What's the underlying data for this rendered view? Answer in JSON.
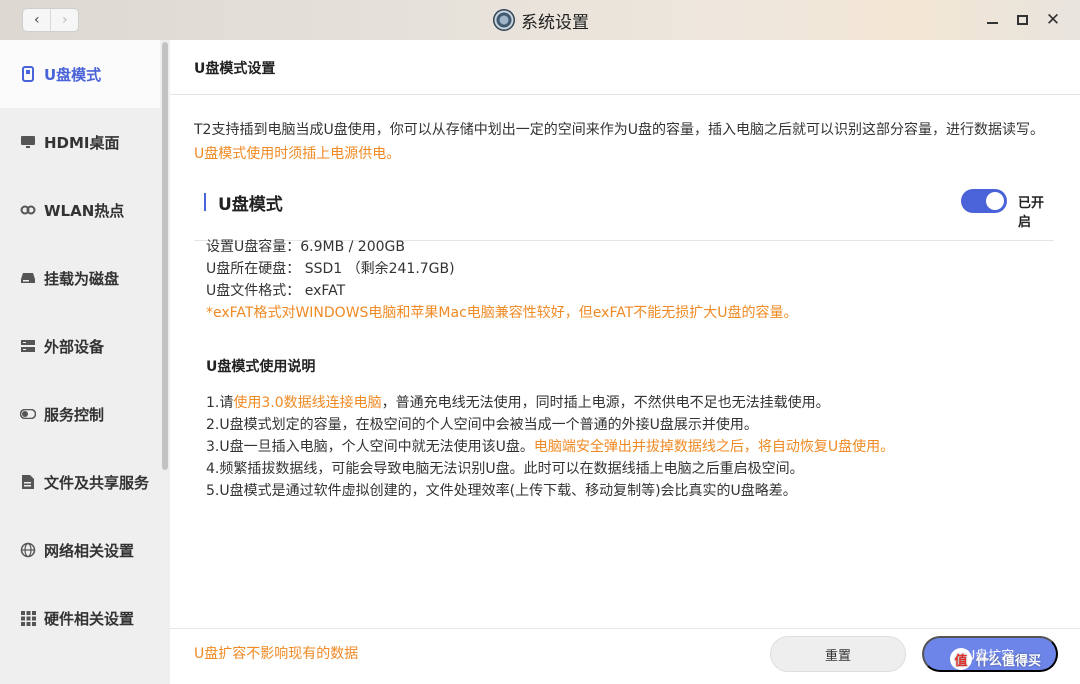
{
  "window": {
    "title": "系统设置",
    "back_icon": "‹",
    "forward_icon": "›"
  },
  "sidebar": {
    "items": [
      {
        "label": "U盘模式",
        "icon": "usb-drive-icon",
        "active": true
      },
      {
        "label": "HDMI桌面",
        "icon": "monitor-icon"
      },
      {
        "label": "WLAN热点",
        "icon": "link-icon"
      },
      {
        "label": "挂载为磁盘",
        "icon": "disk-icon"
      },
      {
        "label": "外部设备",
        "icon": "device-icon"
      },
      {
        "label": "服务控制",
        "icon": "toggle-icon"
      },
      {
        "label": "文件及共享服务",
        "icon": "file-icon"
      },
      {
        "label": "网络相关设置",
        "icon": "globe-icon"
      },
      {
        "label": "硬件相关设置",
        "icon": "grid-icon"
      }
    ]
  },
  "main": {
    "title": "U盘模式设置",
    "desc_text": "T2支持插到电脑当成U盘使用，你可以从存储中划出一定的空间来作为U盘的容量，插入电脑之后就可以识别这部分容量，进行数据读写。",
    "desc_warning": "U盘模式使用时须插上电源供电。",
    "section_title": "U盘模式",
    "toggle_label": "已开启",
    "info": {
      "capacity": "设置U盘容量：6.9MB / 200GB",
      "disk": "U盘所在硬盘：  SSD1  （剩余241.7GB)",
      "format": "U盘文件格式：  exFAT",
      "note": "*exFAT格式对WINDOWS电脑和苹果Mac电脑兼容性较好，但exFAT不能无损扩大U盘的容量。"
    },
    "usage_title": "U盘模式使用说明",
    "usage": {
      "l1_a": "1.请",
      "l1_b": "使用3.0数据线连接电脑",
      "l1_c": "，普通充电线无法使用，同时插上电源，不然供电不足也无法挂载使用。",
      "l2": "2.U盘模式划定的容量，在极空间的个人空间中会被当成一个普通的外接U盘展示并使用。",
      "l3_a": "3.U盘一旦插入电脑，个人空间中就无法使用该U盘。",
      "l3_b": "电脑端安全弹出并拔掉数据线之后，将自动恢复U盘使用。",
      "l4": "4.频繁插拔数据线，可能会导致电脑无法识别U盘。此时可以在数据线插上电脑之后重启极空间。",
      "l5": "5.U盘模式是通过软件虚拟创建的，文件处理效率(上传下载、移动复制等)会比真实的U盘略差。"
    },
    "footer_note": "U盘扩容不影响现有的数据",
    "reset_label": "重置",
    "expand_label": "U盘扩容"
  },
  "watermark": {
    "logo": "值",
    "text": "什么值得买"
  },
  "colors": {
    "accent": "#4a63d8",
    "warning": "#f08a24"
  }
}
